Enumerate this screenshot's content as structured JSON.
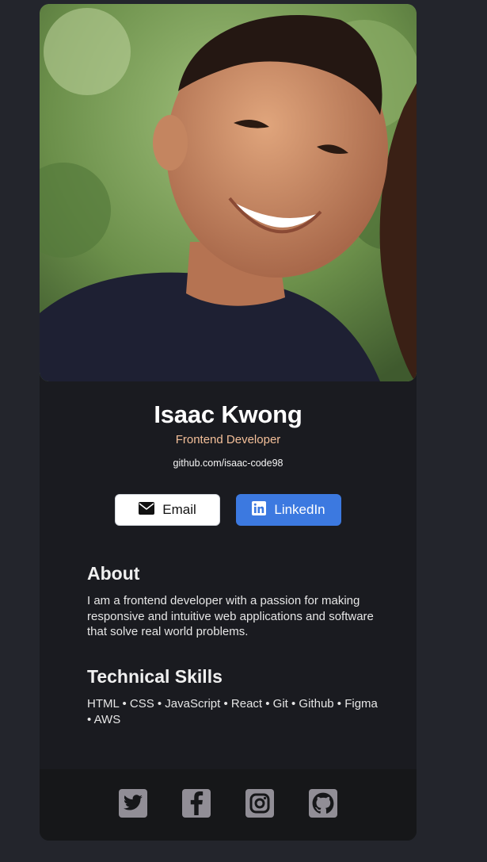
{
  "profile": {
    "name": "Isaac Kwong",
    "role": "Frontend Developer",
    "website": "github.com/isaac-code98"
  },
  "buttons": {
    "email_label": "Email",
    "linkedin_label": "LinkedIn"
  },
  "about": {
    "title": "About",
    "text": "I am a frontend developer with a passion for making responsive and intuitive web applications and software that solve real world problems."
  },
  "skills": {
    "title": "Technical Skills",
    "text": "HTML • CSS • JavaScript • React • Git • Github • Figma • AWS"
  },
  "footer": {
    "icons": [
      "twitter-icon",
      "facebook-icon",
      "instagram-icon",
      "github-icon"
    ]
  },
  "colors": {
    "background": "#23252c",
    "card": "#1a1b20",
    "footer": "#161719",
    "accent_role": "#f3bf99",
    "linkedin_blue": "#3c79e0",
    "social_icon": "#918e96"
  }
}
